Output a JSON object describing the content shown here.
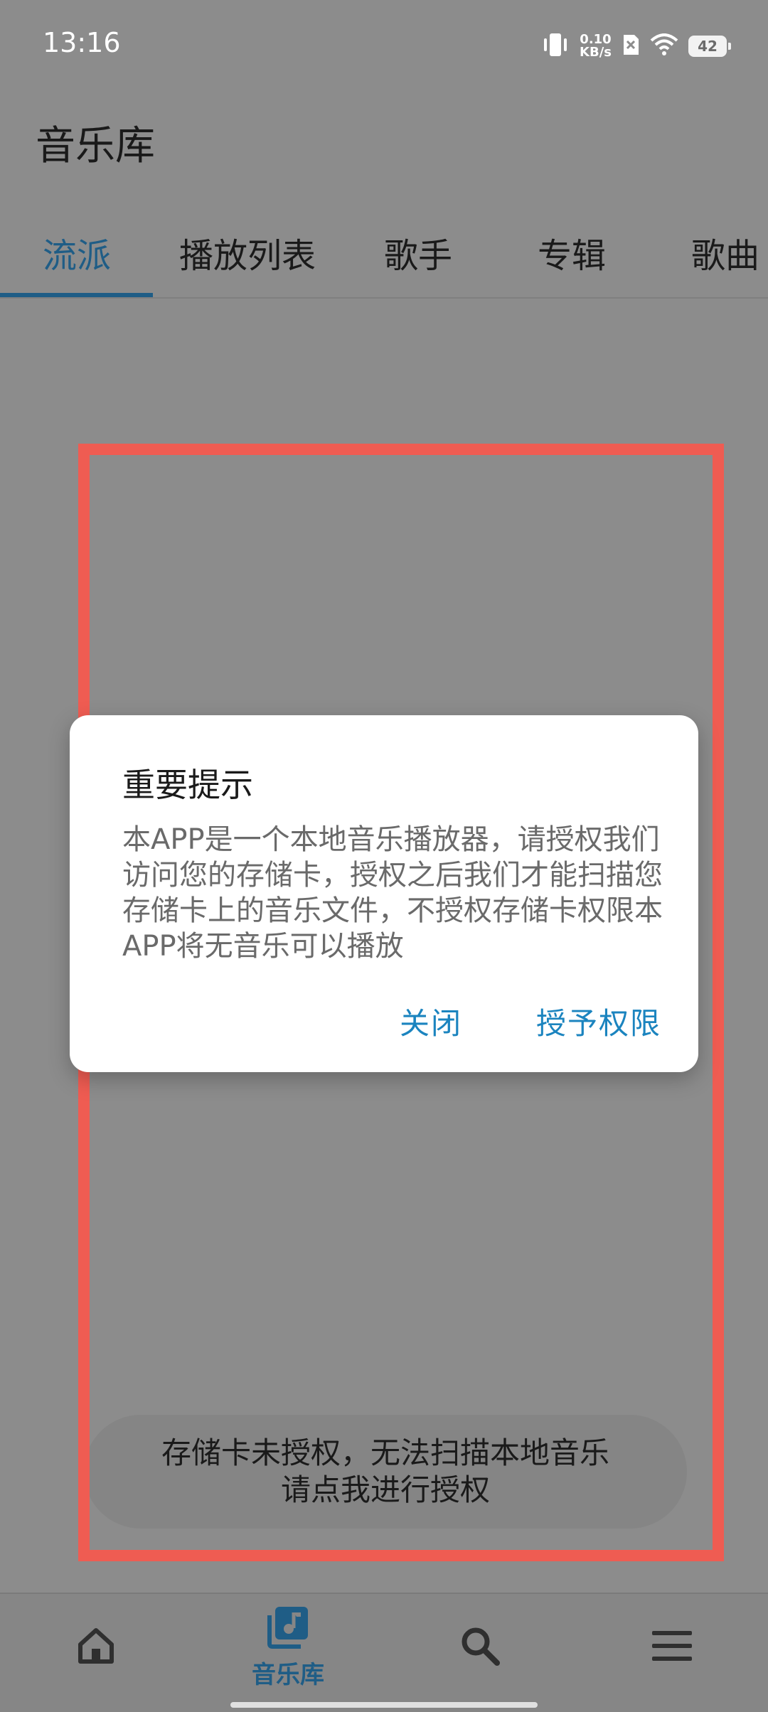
{
  "status_bar": {
    "time": "13:16",
    "net_speed_value": "0.10",
    "net_speed_unit": "KB/s",
    "battery": "42",
    "icons": [
      "vibrate-icon",
      "sim-off-icon",
      "wifi-icon",
      "battery-icon"
    ]
  },
  "header": {
    "title": "音乐库"
  },
  "tabs": [
    {
      "label": "流派",
      "active": true
    },
    {
      "label": "播放列表",
      "active": false
    },
    {
      "label": "歌手",
      "active": false
    },
    {
      "label": "专辑",
      "active": false
    },
    {
      "label": "歌曲",
      "active": false
    }
  ],
  "dialog": {
    "title": "重要提示",
    "message": "本APP是一个本地音乐播放器，请授权我们访问您的存储卡，授权之后我们才能扫描您存储卡上的音乐文件，不授权存储卡权限本APP将无音乐可以播放",
    "close_label": "关闭",
    "grant_label": "授予权限"
  },
  "storage_notice": {
    "line1": "存储卡未授权，无法扫描本地音乐",
    "line2": "请点我进行授权"
  },
  "bottom_nav": {
    "items": [
      {
        "icon": "home-icon",
        "label": ""
      },
      {
        "icon": "music-library-icon",
        "label": "音乐库",
        "active": true
      },
      {
        "icon": "search-icon",
        "label": ""
      },
      {
        "icon": "menu-icon",
        "label": ""
      }
    ]
  },
  "colors": {
    "accent": "#1f5d86",
    "dialog_button": "#1b84bf",
    "highlight_frame": "#ef5c52",
    "scrim_background": "#8c8c8c"
  }
}
